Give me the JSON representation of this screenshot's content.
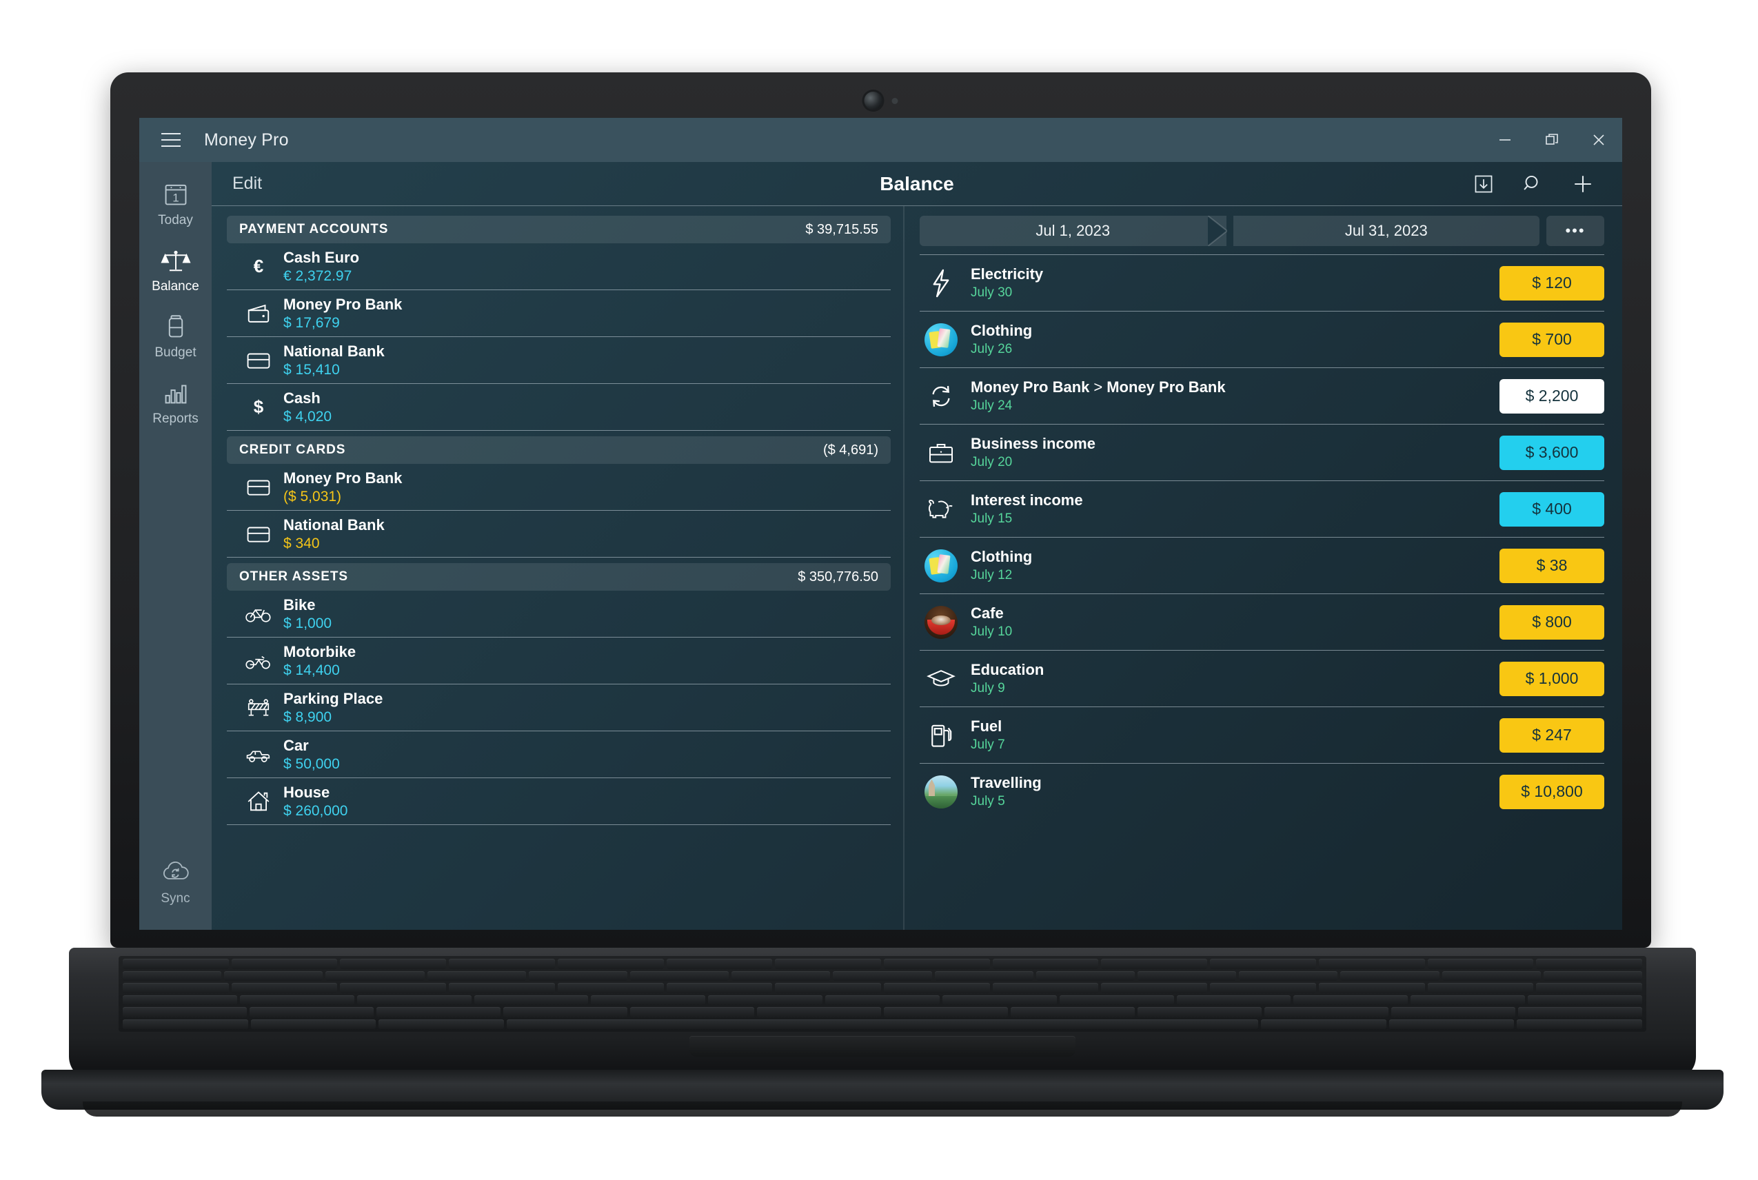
{
  "window": {
    "app_title": "Money Pro",
    "menu_icon": "hamburger-icon",
    "controls": {
      "minimize": "minimize-icon",
      "restore": "restore-icon",
      "close": "close-icon"
    }
  },
  "sidebar": {
    "items": [
      {
        "label": "Today",
        "icon": "calendar-icon",
        "active": false
      },
      {
        "label": "Balance",
        "icon": "scales-icon",
        "active": true
      },
      {
        "label": "Budget",
        "icon": "battery-icon",
        "active": false
      },
      {
        "label": "Reports",
        "icon": "bar-chart-icon",
        "active": false
      }
    ],
    "sync": {
      "label": "Sync",
      "icon": "cloud-sync-icon"
    }
  },
  "toolbar": {
    "edit_label": "Edit",
    "title": "Balance",
    "actions": [
      {
        "name": "import-icon"
      },
      {
        "name": "search-icon"
      },
      {
        "name": "add-icon"
      }
    ]
  },
  "accounts": {
    "sections": [
      {
        "title": "PAYMENT ACCOUNTS",
        "total": "$ 39,715.55",
        "rows": [
          {
            "icon": "euro-sign-icon",
            "name": "Cash Euro",
            "amount": "€ 2,372.97",
            "tone": "pos"
          },
          {
            "icon": "wallet-icon",
            "name": "Money Pro Bank",
            "amount": "$ 17,679",
            "tone": "pos"
          },
          {
            "icon": "credit-card-icon",
            "name": "National Bank",
            "amount": "$ 15,410",
            "tone": "pos"
          },
          {
            "icon": "dollar-sign-icon",
            "name": "Cash",
            "amount": "$ 4,020",
            "tone": "pos"
          }
        ]
      },
      {
        "title": "CREDIT CARDS",
        "total": "($ 4,691)",
        "rows": [
          {
            "icon": "credit-card-icon",
            "name": "Money Pro Bank",
            "amount": "($ 5,031)",
            "tone": "neg"
          },
          {
            "icon": "credit-card-icon",
            "name": "National Bank",
            "amount": "$ 340",
            "tone": "warn"
          }
        ]
      },
      {
        "title": "OTHER ASSETS",
        "total": "$ 350,776.50",
        "rows": [
          {
            "icon": "bicycle-icon",
            "name": "Bike",
            "amount": "$ 1,000",
            "tone": "pos"
          },
          {
            "icon": "motorbike-icon",
            "name": "Motorbike",
            "amount": "$ 14,400",
            "tone": "pos"
          },
          {
            "icon": "barrier-icon",
            "name": "Parking Place",
            "amount": "$ 8,900",
            "tone": "pos"
          },
          {
            "icon": "car-icon",
            "name": "Car",
            "amount": "$ 50,000",
            "tone": "pos"
          },
          {
            "icon": "house-icon",
            "name": "House",
            "amount": "$ 260,000",
            "tone": "pos"
          }
        ]
      }
    ]
  },
  "transactions": {
    "date_from": "Jul 1, 2023",
    "date_to": "Jul 31, 2023",
    "more_label": "•••",
    "rows": [
      {
        "icon": "lightning-icon",
        "name": "Electricity",
        "to": "",
        "date": "July 30",
        "amount": "$ 120",
        "kind": "expense"
      },
      {
        "icon": "clothing-photo",
        "name": "Clothing",
        "to": "",
        "date": "July 26",
        "amount": "$ 700",
        "kind": "expense"
      },
      {
        "icon": "transfer-icon",
        "name": "Money Pro Bank",
        "to": "Money Pro Bank",
        "date": "July 24",
        "amount": "$ 2,200",
        "kind": "transfer"
      },
      {
        "icon": "briefcase-icon",
        "name": "Business income",
        "to": "",
        "date": "July 20",
        "amount": "$ 3,600",
        "kind": "income"
      },
      {
        "icon": "piggy-bank-icon",
        "name": "Interest income",
        "to": "",
        "date": "July 15",
        "amount": "$ 400",
        "kind": "income"
      },
      {
        "icon": "clothing-photo",
        "name": "Clothing",
        "to": "",
        "date": "July 12",
        "amount": "$ 38",
        "kind": "expense"
      },
      {
        "icon": "cafe-photo",
        "name": "Cafe",
        "to": "",
        "date": "July 10",
        "amount": "$ 800",
        "kind": "expense"
      },
      {
        "icon": "graduation-icon",
        "name": "Education",
        "to": "",
        "date": "July 9",
        "amount": "$ 1,000",
        "kind": "expense"
      },
      {
        "icon": "fuel-pump-icon",
        "name": "Fuel",
        "to": "",
        "date": "July 7",
        "amount": "$ 247",
        "kind": "expense"
      },
      {
        "icon": "travel-photo",
        "name": "Travelling",
        "to": "",
        "date": "July 5",
        "amount": "$ 10,800",
        "kind": "expense"
      }
    ]
  },
  "colors": {
    "expense_badge": "#f9c713",
    "income_badge": "#23cfee",
    "transfer_badge": "#ffffff",
    "amount_positive": "#3fd2ef",
    "amount_negative": "#f5c518",
    "date_text": "#56d69b",
    "titlebar": "#3a525e",
    "sidebar": "#3a4d58"
  }
}
